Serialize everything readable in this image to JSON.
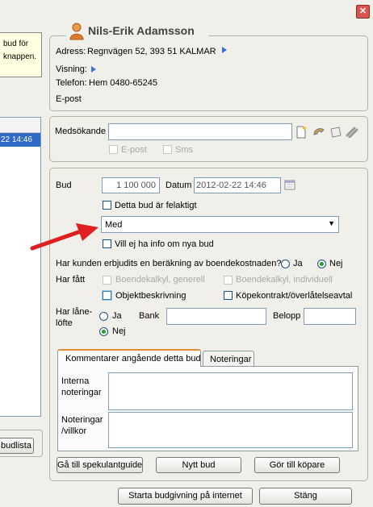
{
  "window": {
    "close_glyph": "✕"
  },
  "left": {
    "tip_line1": "bud för",
    "tip_line2": "knappen.",
    "selected_time": "22 14:46",
    "budlista_label": "budlista"
  },
  "contact": {
    "name": "Nils-Erik Adamsson",
    "address_label": "Adress:",
    "address_value": "Regnvägen 52, 393 51  KALMAR",
    "visning_label": "Visning:",
    "phone_label": "Telefon:",
    "phone_value": "Hem 0480-65245",
    "email_label": "E-post"
  },
  "co_applicant": {
    "label": "Medsökande",
    "value": "",
    "email_label": "E-post",
    "sms_label": "Sms",
    "icons": [
      "new-document-icon",
      "phone-icon",
      "card-icon",
      "link-icon"
    ]
  },
  "bid": {
    "bud_label": "Bud",
    "bud_value": "1 100 000",
    "datum_label": "Datum",
    "datum_value": "2012-02-22 14:46",
    "incorrect_label": "Detta bud är felaktigt",
    "dropdown_value": "Med",
    "no_info_label": "Vill ej ha info om nya bud",
    "housing_question": "Har kunden erbjudits en beräkning av boendekostnaden?",
    "ja": "Ja",
    "nej": "Nej",
    "housing_answer": "Nej",
    "har_fatt_label": "Har fått",
    "boendekalkyl_generell": "Boendekalkyl, generell",
    "boendekalkyl_individuell": "Boendekalkyl, individuell",
    "objektbeskrivning": "Objektbeskrivning",
    "kopekontrakt": "Köpekontrakt/överlåtelseavtal",
    "loan_label_1": "Har låne-",
    "loan_label_2": "löfte",
    "loan_answer": "Nej",
    "bank_label": "Bank",
    "bank_value": "",
    "belopp_label": "Belopp",
    "belopp_value": ""
  },
  "tabs": [
    {
      "label": "Kommentarer angående detta bud",
      "active": true
    },
    {
      "label": "Noteringar",
      "active": false
    }
  ],
  "notes": {
    "internal_1": "Interna",
    "internal_2": "noteringar",
    "conditions_1": "Noteringar",
    "conditions_2": "/villkor"
  },
  "buttons": {
    "speculant": "Gå till spekulantguide",
    "new_bid": "Nytt bud",
    "make_buyer": "Gör till köpare",
    "start_internet": "Starta budgivning på internet",
    "close": "Stäng"
  },
  "colors": {
    "arrow": "#e02020",
    "selection": "#3169c6",
    "radio_selected": "#21a121"
  }
}
